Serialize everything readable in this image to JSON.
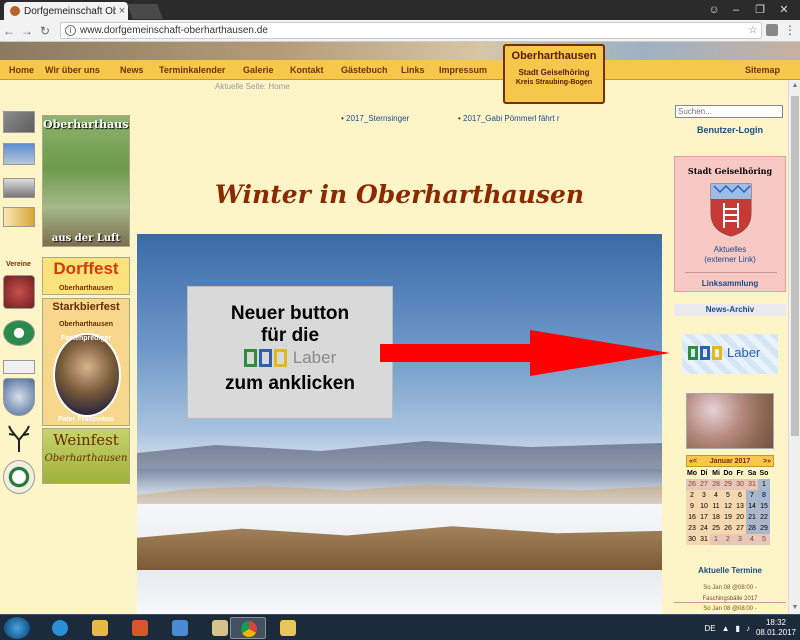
{
  "browser": {
    "tab_title": "Dorfgemeinschaft Oberh",
    "tab_close": "×",
    "url": "www.dorfgemeinschaft-oberharthausen.de",
    "window_buttons": [
      "–",
      "❐",
      "✕"
    ]
  },
  "nav": {
    "items": [
      "Home",
      "Wir über uns",
      "News",
      "Terminkalender",
      "Galerie",
      "Kontakt",
      "Gästebuch",
      "Links",
      "Impressum"
    ],
    "sitemap": "Sitemap"
  },
  "logo": {
    "line1": "Oberharthausen",
    "line2": "Stadt Geiselhöring",
    "line3": "Kreis Straubing-Bogen"
  },
  "breadcrumb": "Aktuelle Seite: Home",
  "left_sidebar": {
    "vereine_label": "Vereine",
    "ads": {
      "aerial_top": "Oberharthausen",
      "aerial_bottom": "aus der Luft",
      "dorffest": "Dorffest",
      "dorffest_sub": "Oberharthausen",
      "starkbier": "Starkbierfest",
      "starkbier_sub": "Oberharthausen",
      "fastenprediger": "Fastenprediger",
      "pater": "Pater Franziskus",
      "weinfest": "Weinfest",
      "weinfest_sub": "Oberharthausen"
    }
  },
  "main": {
    "sublinks": [
      "2017_Sternsinger",
      "2017_Gabi Pömmerl fährt r"
    ],
    "title": "Winter in Oberharthausen",
    "overlay": {
      "line1": "Neuer button",
      "line2": "für die",
      "ile_word": "Laber",
      "line4": "zum anklicken"
    }
  },
  "right_sidebar": {
    "search_placeholder": "Suchen...",
    "login": "Benutzer-Login",
    "geisel_title": "Stadt Geiselhöring",
    "aktuelles_line1": "Aktuelles",
    "aktuelles_line2": "(externer Link)",
    "linksammlung": "Linksammlung",
    "news_archiv": "News-Archiv",
    "ile_word": "Laber",
    "calendar": {
      "month": "Januar 2017",
      "prev": "«<",
      "next": ">»",
      "weekdays": [
        "Mo",
        "Di",
        "Mi",
        "Do",
        "Fr",
        "Sa",
        "So"
      ],
      "weeks": [
        [
          "26",
          "27",
          "28",
          "29",
          "30",
          "31",
          "1"
        ],
        [
          "2",
          "3",
          "4",
          "5",
          "6",
          "7",
          "8"
        ],
        [
          "9",
          "10",
          "11",
          "12",
          "13",
          "14",
          "15"
        ],
        [
          "16",
          "17",
          "18",
          "19",
          "20",
          "21",
          "22"
        ],
        [
          "23",
          "24",
          "25",
          "26",
          "27",
          "28",
          "29"
        ],
        [
          "30",
          "31",
          "1",
          "2",
          "3",
          "4",
          "5"
        ]
      ]
    },
    "termine_title": "Aktuelle Termine",
    "termine": [
      "So Jan 08 @08:00 -",
      "Faschingsbälle 2017",
      "So Jan 08 @08:00 -"
    ]
  },
  "taskbar": {
    "lang": "DE",
    "time": "18:32",
    "date": "08.01.2017"
  },
  "colors": {
    "page_bg": "#fdf5c8",
    "nav_bg": "#f5c84c",
    "nav_text": "#7a2e00",
    "title_color": "#8b2a00",
    "link_blue": "#1a4b8a",
    "arrow_red": "#ff0000"
  }
}
